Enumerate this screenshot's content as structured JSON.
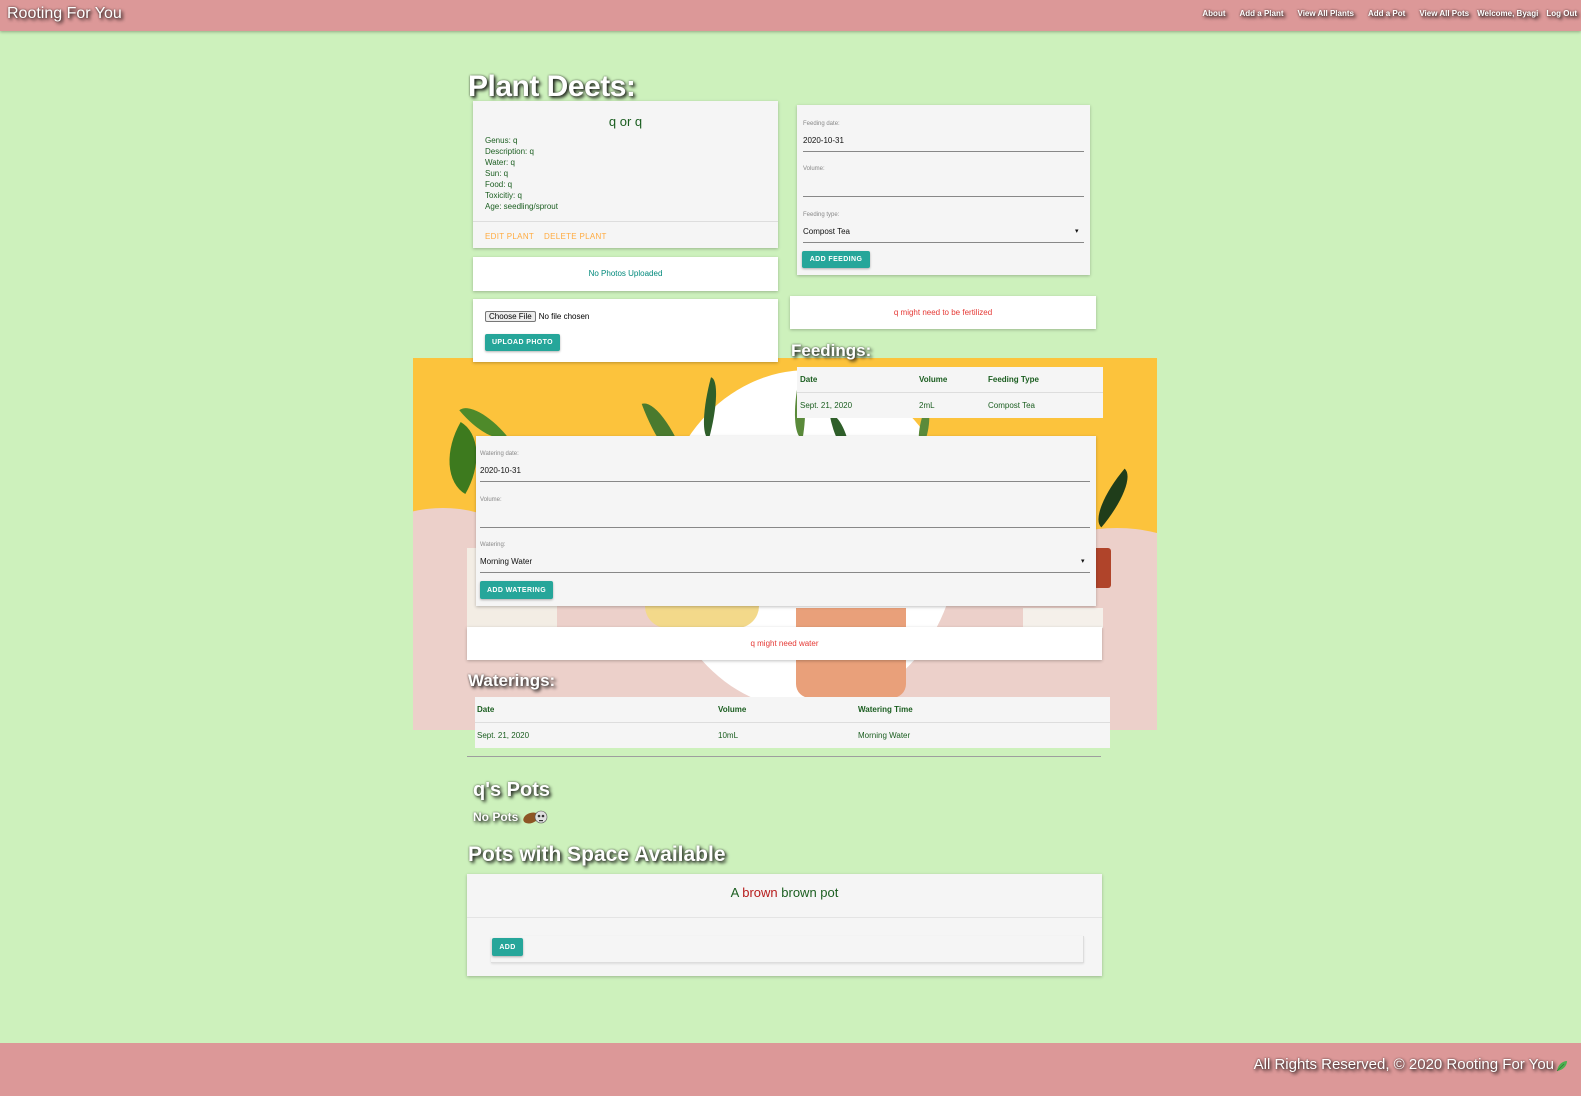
{
  "nav": {
    "brand": "Rooting For You",
    "links": [
      "About",
      "Add a Plant",
      "View All Plants",
      "Add a Pot",
      "View All Pots"
    ],
    "welcome": "Welcome, Byagi",
    "logout": "Log Out"
  },
  "page_title": "Plant Deets:",
  "plant": {
    "name": "q or q",
    "genus": "Genus: q",
    "description": "Description: q",
    "water": "Water: q",
    "sun": "Sun: q",
    "food": "Food: q",
    "toxicity": "Toxicitiy: q",
    "age": "Age: seedling/sprout",
    "edit_label": "EDIT PLANT",
    "delete_label": "DELETE PLANT"
  },
  "photos": {
    "empty_text": "No Photos Uploaded",
    "choose_file": "Choose File",
    "no_file": "No file chosen",
    "upload_label": "UPLOAD PHOTO"
  },
  "feeding_form": {
    "date_label": "Feeding date:",
    "date_value": "2020-10-31",
    "volume_label": "Volume:",
    "volume_value": "",
    "type_label": "Feeding type:",
    "type_value": "Compost Tea",
    "submit_label": "ADD FEEDING"
  },
  "fertilize_notice": "q might need to be fertilized",
  "feedings": {
    "title": "Feedings:",
    "headers": [
      "Date",
      "Volume",
      "Feeding Type"
    ],
    "rows": [
      [
        "Sept. 21, 2020",
        "2mL",
        "Compost Tea"
      ]
    ]
  },
  "watering_form": {
    "date_label": "Watering date:",
    "date_value": "2020-10-31",
    "volume_label": "Volume:",
    "volume_value": "",
    "type_label": "Watering:",
    "type_value": "Morning Water",
    "submit_label": "ADD WATERING"
  },
  "water_notice": "q might need water",
  "waterings": {
    "title": "Waterings:",
    "headers": [
      "Date",
      "Volume",
      "Watering Time"
    ],
    "rows": [
      [
        "Sept. 21, 2020",
        "10mL",
        "Morning Water"
      ]
    ]
  },
  "pots": {
    "title": "q's Pots",
    "empty_text": "No Pots"
  },
  "pots_available": {
    "title": "Pots with Space Available",
    "items": [
      {
        "prefix": "A",
        "color": "brown",
        "name": "brown pot",
        "add_label": "ADD"
      }
    ]
  },
  "footer": {
    "text": "All Rights Reserved, © 2020 Rooting For You"
  },
  "colors": {
    "background": "#cdf1bc",
    "navbar": "#dc9898",
    "accent": "#26a69a",
    "alert": "#e53935",
    "link_orange": "#ffab40"
  }
}
